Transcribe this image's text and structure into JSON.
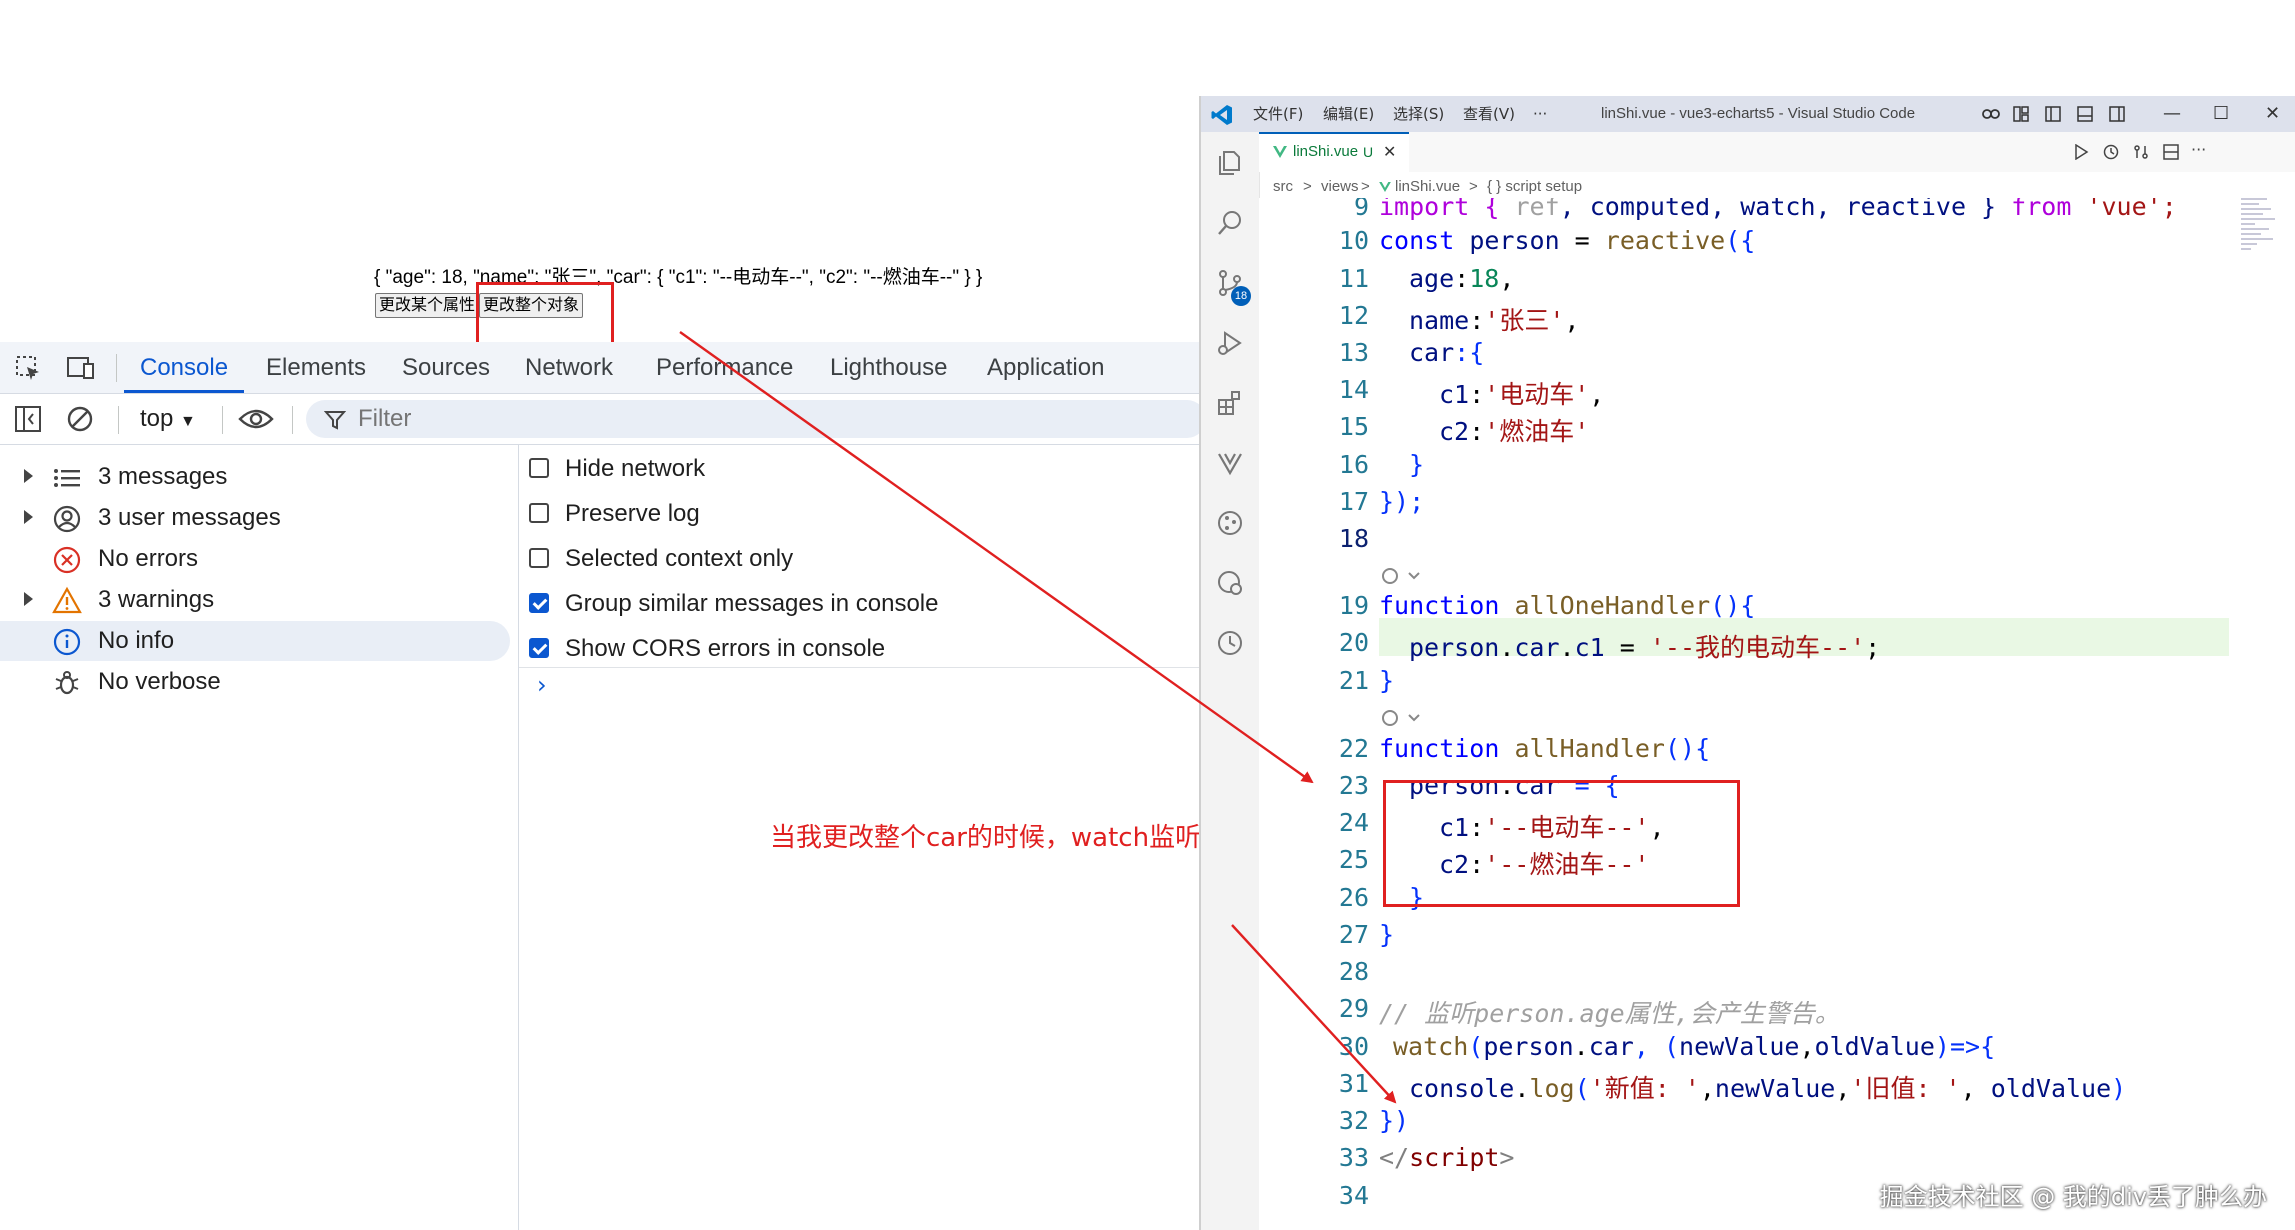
{
  "page": {
    "json_output": "{ \"age\": 18, \"name\": \"张三\", \"car\": { \"c1\": \"--电动车--\", \"c2\": \"--燃油车--\" } }",
    "buttons": [
      "更改某个属性",
      "更改整个对象"
    ]
  },
  "devtools": {
    "tabs": [
      "Console",
      "Elements",
      "Sources",
      "Network",
      "Performance",
      "Lighthouse",
      "Application"
    ],
    "active_tab": "Console",
    "context": "top",
    "filter_placeholder": "Filter",
    "sidebar": [
      {
        "label": "3 messages",
        "icon": "list-icon",
        "expandable": true
      },
      {
        "label": "3 user messages",
        "icon": "user-icon",
        "expandable": true
      },
      {
        "label": "No errors",
        "icon": "error-icon",
        "expandable": false
      },
      {
        "label": "3 warnings",
        "icon": "warning-icon",
        "expandable": true
      },
      {
        "label": "No info",
        "icon": "info-icon",
        "expandable": false,
        "selected": true
      },
      {
        "label": "No verbose",
        "icon": "bug-icon",
        "expandable": false
      }
    ],
    "settings": [
      {
        "label": "Hide network",
        "checked": false
      },
      {
        "label": "Preserve log",
        "checked": false
      },
      {
        "label": "Selected context only",
        "checked": false
      },
      {
        "label": "Group similar messages in console",
        "checked": true
      },
      {
        "label": "Show CORS errors in console",
        "checked": true
      }
    ],
    "prompt": "›"
  },
  "annotation": "当我更改整个car的时候，watch监听不到了",
  "vscode": {
    "menus": [
      "文件(F)",
      "编辑(E)",
      "选择(S)",
      "查看(V)",
      "···"
    ],
    "title": "linShi.vue - vue3-echarts5 - Visual Studio Code",
    "tab_label": "linShi.vue",
    "tab_status": "U",
    "breadcrumb": [
      "src",
      ">",
      "views",
      ">",
      "linShi.vue",
      ">",
      "{ } script setup"
    ],
    "scm_badge": "18",
    "line_numbers": [
      "9",
      "10",
      "11",
      "12",
      "13",
      "14",
      "15",
      "16",
      "17",
      "18",
      "19",
      "20",
      "21",
      "22",
      "23",
      "24",
      "25",
      "26",
      "27",
      "28",
      "29",
      "30",
      "31",
      "32",
      "33",
      "34"
    ],
    "code_text": {
      "l9_a": "import { ",
      "l9_b": "ref",
      "l9_c": ", computed, watch, reactive } ",
      "l9_d": "from",
      "l9_e": " 'vue';",
      "l10_a": "const",
      "l10_b": " person",
      "l10_c": " = ",
      "l10_d": "reactive",
      "l10_e": "({",
      "l11_a": "age",
      "l11_b": ":",
      "l11_c": "18",
      "l11_d": ",",
      "l12_a": "name",
      "l12_b": ":",
      "l12_c": "'张三'",
      "l12_d": ",",
      "l13_a": "car",
      "l13_b": ":{",
      "l14_a": "c1",
      "l14_b": ":",
      "l14_c": "'电动车'",
      "l14_d": ",",
      "l15_a": "c2",
      "l15_b": ":",
      "l15_c": "'燃油车'",
      "l16": "}",
      "l17": "});",
      "l19_a": "function",
      "l19_b": " allOneHandler",
      "l19_c": "(){",
      "l20_a": "person",
      "l20_b": ".",
      "l20_c": "car",
      "l20_d": ".",
      "l20_e": "c1",
      "l20_f": " = ",
      "l20_g": "'--我的电动车--'",
      "l20_h": ";",
      "l21": "}",
      "l22_a": "function",
      "l22_b": " allHandler",
      "l22_c": "(){",
      "l23_a": "person",
      "l23_b": ".",
      "l23_c": "car",
      "l23_d": " = {",
      "l24_a": "c1",
      "l24_b": ":",
      "l24_c": "'--电动车--'",
      "l24_d": ",",
      "l25_a": "c2",
      "l25_b": ":",
      "l25_c": "'--燃油车--'",
      "l26": "}",
      "l27": "}",
      "l29": "// 监听person.age属性,会产生警告。",
      "l30_a": "watch",
      "l30_b": "(",
      "l30_c": "person",
      "l30_d": ".",
      "l30_e": "car",
      "l30_f": ", (",
      "l30_g": "newValue",
      "l30_h": ",",
      "l30_i": "oldValue",
      "l30_j": ")=>{",
      "l31_a": "console",
      "l31_b": ".",
      "l31_c": "log",
      "l31_d": "(",
      "l31_e": "'新值: '",
      "l31_f": ",",
      "l31_g": "newValue",
      "l31_h": ",",
      "l31_i": "'旧值: '",
      "l31_j": ", ",
      "l31_k": "oldValue",
      "l31_l": ")",
      "l32": "})",
      "l33_a": "</",
      "l33_b": "script",
      "l33_c": ">"
    }
  },
  "watermark": "掘金技术社区 @ 我的div丢了肿么办",
  "colors": {
    "annotation_red": "#e02020",
    "devtools_accent": "#0b57d0",
    "vscode_accent": "#005fb8"
  }
}
